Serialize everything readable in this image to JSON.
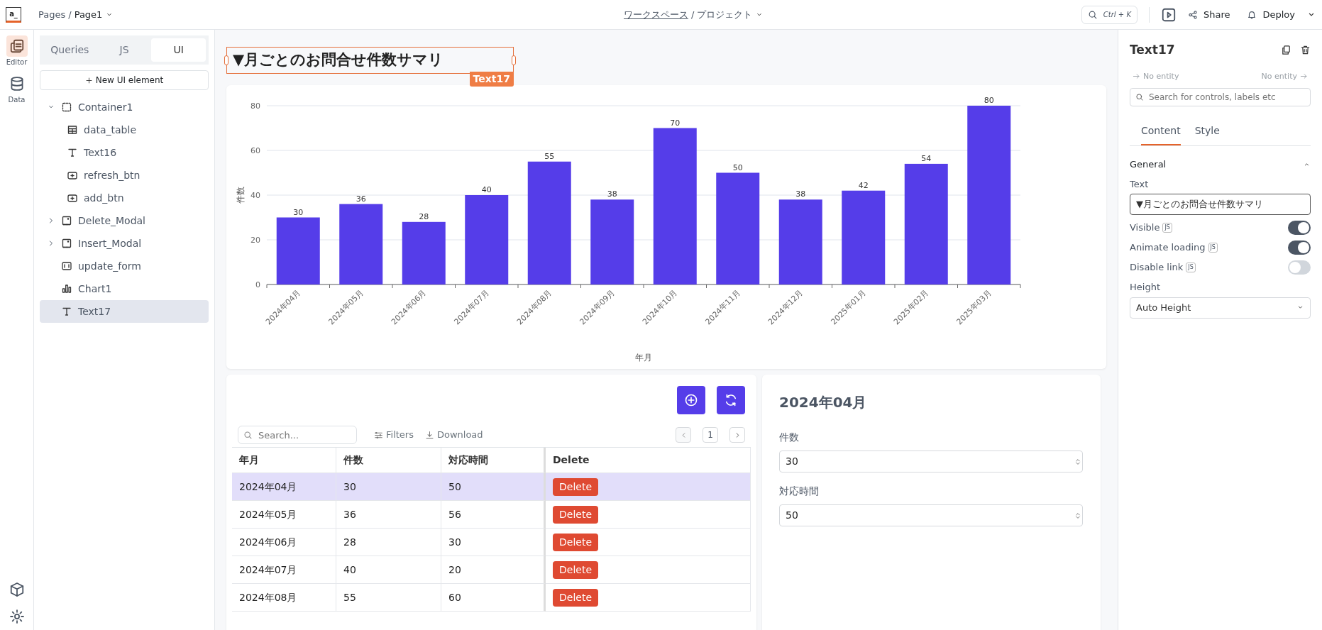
{
  "top_bar": {
    "logo": "a_",
    "pages_label": "Pages",
    "pages_separator": "/",
    "page": "Page1",
    "project_separator": "/",
    "workspace": "ワークスペース",
    "project": "プロジェクト",
    "search_shortcut": "Ctrl + K",
    "share": "Share",
    "deploy": "Deploy"
  },
  "rail": [
    {
      "label": "Editor",
      "kind": "editor",
      "selected": true
    },
    {
      "label": "Data",
      "kind": "data",
      "selected": false
    }
  ],
  "sidebar": {
    "tabs": [
      {
        "label": "Queries",
        "selected": false
      },
      {
        "label": "JS",
        "selected": false
      },
      {
        "label": "UI",
        "selected": true
      }
    ],
    "new_button": "New UI element",
    "items": [
      {
        "label": "Container1",
        "kind": "container",
        "expanded": true,
        "selected": false,
        "children": [
          {
            "label": "data_table",
            "kind": "table",
            "selected": false
          },
          {
            "label": "Text16",
            "kind": "text",
            "selected": false
          },
          {
            "label": "refresh_btn",
            "kind": "button",
            "selected": false
          },
          {
            "label": "add_btn",
            "kind": "button",
            "selected": false
          }
        ]
      },
      {
        "label": "Delete_Modal",
        "kind": "modal",
        "expanded": false,
        "selected": false
      },
      {
        "label": "Insert_Modal",
        "kind": "modal",
        "expanded": false,
        "selected": false
      },
      {
        "label": "update_form",
        "kind": "form",
        "selected": false
      },
      {
        "label": "Chart1",
        "kind": "chart",
        "selected": false
      },
      {
        "label": "Text17",
        "kind": "text",
        "selected": true
      }
    ]
  },
  "canvas": {
    "title": "▼月ごとのお問合せ件数サマリ",
    "selection_tag": "Text17",
    "chart": {
      "chart_data": {
        "type": "bar",
        "xlabel": "年月",
        "ylabel": "件数",
        "categories": [
          "2024年04月",
          "2024年05月",
          "2024年06月",
          "2024年07月",
          "2024年08月",
          "2024年09月",
          "2024年10月",
          "2024年11月",
          "2024年12月",
          "2025年01月",
          "2025年02月",
          "2025年03月"
        ],
        "series": [
          {
            "color": "#553de9",
            "values": [
              30,
              36,
              28,
              40,
              55,
              38,
              70,
              50,
              38,
              42,
              54,
              80
            ]
          }
        ],
        "ylim": [
          0,
          80
        ],
        "yticks": [
          0,
          20,
          40,
          60,
          80
        ],
        "grid": true,
        "data_labels": true
      }
    },
    "table": {
      "search_placeholder": "Search...",
      "filters": "Filters",
      "download": "Download",
      "page": "1",
      "columns": [
        "年月",
        "件数",
        "対応時間",
        "Delete"
      ],
      "rows": [
        {
          "cells": [
            "2024年04月",
            "30",
            "50"
          ],
          "action": "Delete",
          "selected": true
        },
        {
          "cells": [
            "2024年05月",
            "36",
            "56"
          ],
          "action": "Delete",
          "selected": false
        },
        {
          "cells": [
            "2024年06月",
            "28",
            "30"
          ],
          "action": "Delete",
          "selected": false
        },
        {
          "cells": [
            "2024年07月",
            "40",
            "20"
          ],
          "action": "Delete",
          "selected": false
        },
        {
          "cells": [
            "2024年08月",
            "55",
            "60"
          ],
          "action": "Delete",
          "selected": false
        }
      ]
    },
    "form": {
      "title": "2024年04月",
      "fields": [
        {
          "label": "件数",
          "value": "30"
        },
        {
          "label": "対応時間",
          "value": "50"
        }
      ]
    }
  },
  "properties": {
    "title": "Text17",
    "from": "No entity",
    "to": "No entity",
    "search_placeholder": "Search for controls, labels etc",
    "tabs": [
      {
        "label": "Content",
        "selected": true
      },
      {
        "label": "Style",
        "selected": false
      }
    ],
    "section": "General",
    "text_label": "Text",
    "text_value": "▼月ごとのお問合せ件数サマリ",
    "toggles": [
      {
        "label": "Visible",
        "badge": "JS",
        "on": true
      },
      {
        "label": "Animate loading",
        "badge": "JS",
        "on": true
      },
      {
        "label": "Disable link",
        "badge": "JS",
        "on": false
      }
    ],
    "height_label": "Height",
    "height_value": "Auto Height"
  }
}
